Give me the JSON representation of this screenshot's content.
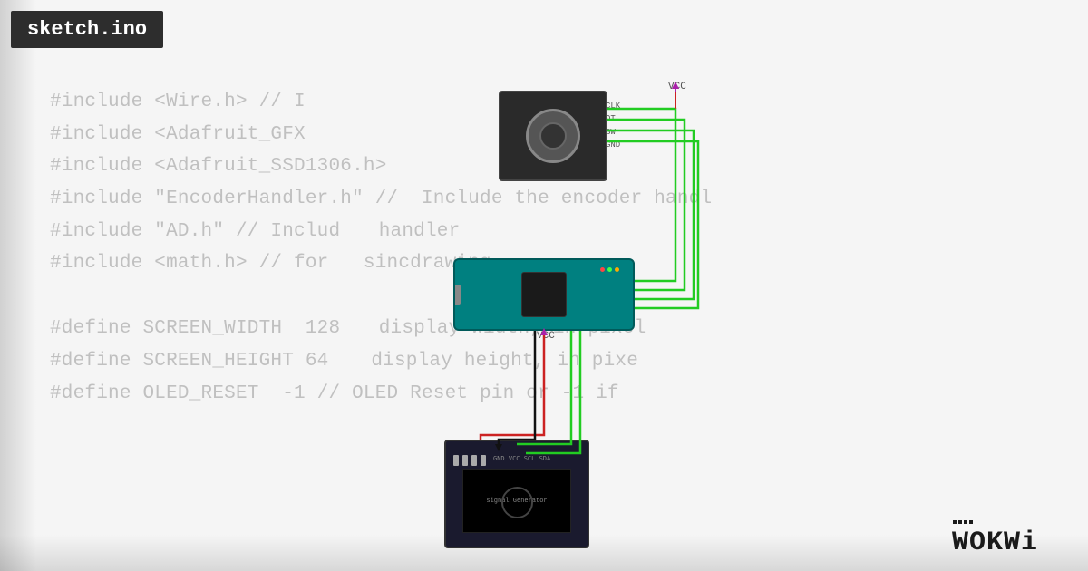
{
  "title": "sketch.ino",
  "code": {
    "lines": [
      "#include <Wire.h> // I",
      "#include <Adafruit_GFX",
      "#include <Adafruit_SSD1306.h>",
      "#include \"EncoderHandler.h\" // Include the encoder handl",
      "#include \"AD.h\" // Includе  handler",
      "#include <math.h> // for  sincdrawing",
      "",
      "#define SCREEN_WIDTH 128  display width, in pixel",
      "#define SCREEN_HEIGHT 64  display height, in pixe",
      "#define OLED_RESET -1 // OLED Reset pin or -1 if",
      ""
    ]
  },
  "encoder": {
    "pins": [
      "CLK",
      "DT",
      "SW",
      "GND"
    ]
  },
  "vcc_labels": [
    "VCC",
    "VCC"
  ],
  "oled": {
    "text": "signal Generator"
  },
  "wokwi_logo": "WOKWi",
  "colors": {
    "background": "#f5f5f5",
    "title_bg": "#2d2d2d",
    "title_text": "#ffffff",
    "code_text": "#c0c0c0",
    "wire_green": "#22cc22",
    "wire_red": "#cc2222",
    "wire_purple": "#aa22aa",
    "wire_black": "#111111",
    "arduino_teal": "#008080",
    "encoder_bg": "#2a2a2a",
    "oled_bg": "#1a1a2e"
  }
}
